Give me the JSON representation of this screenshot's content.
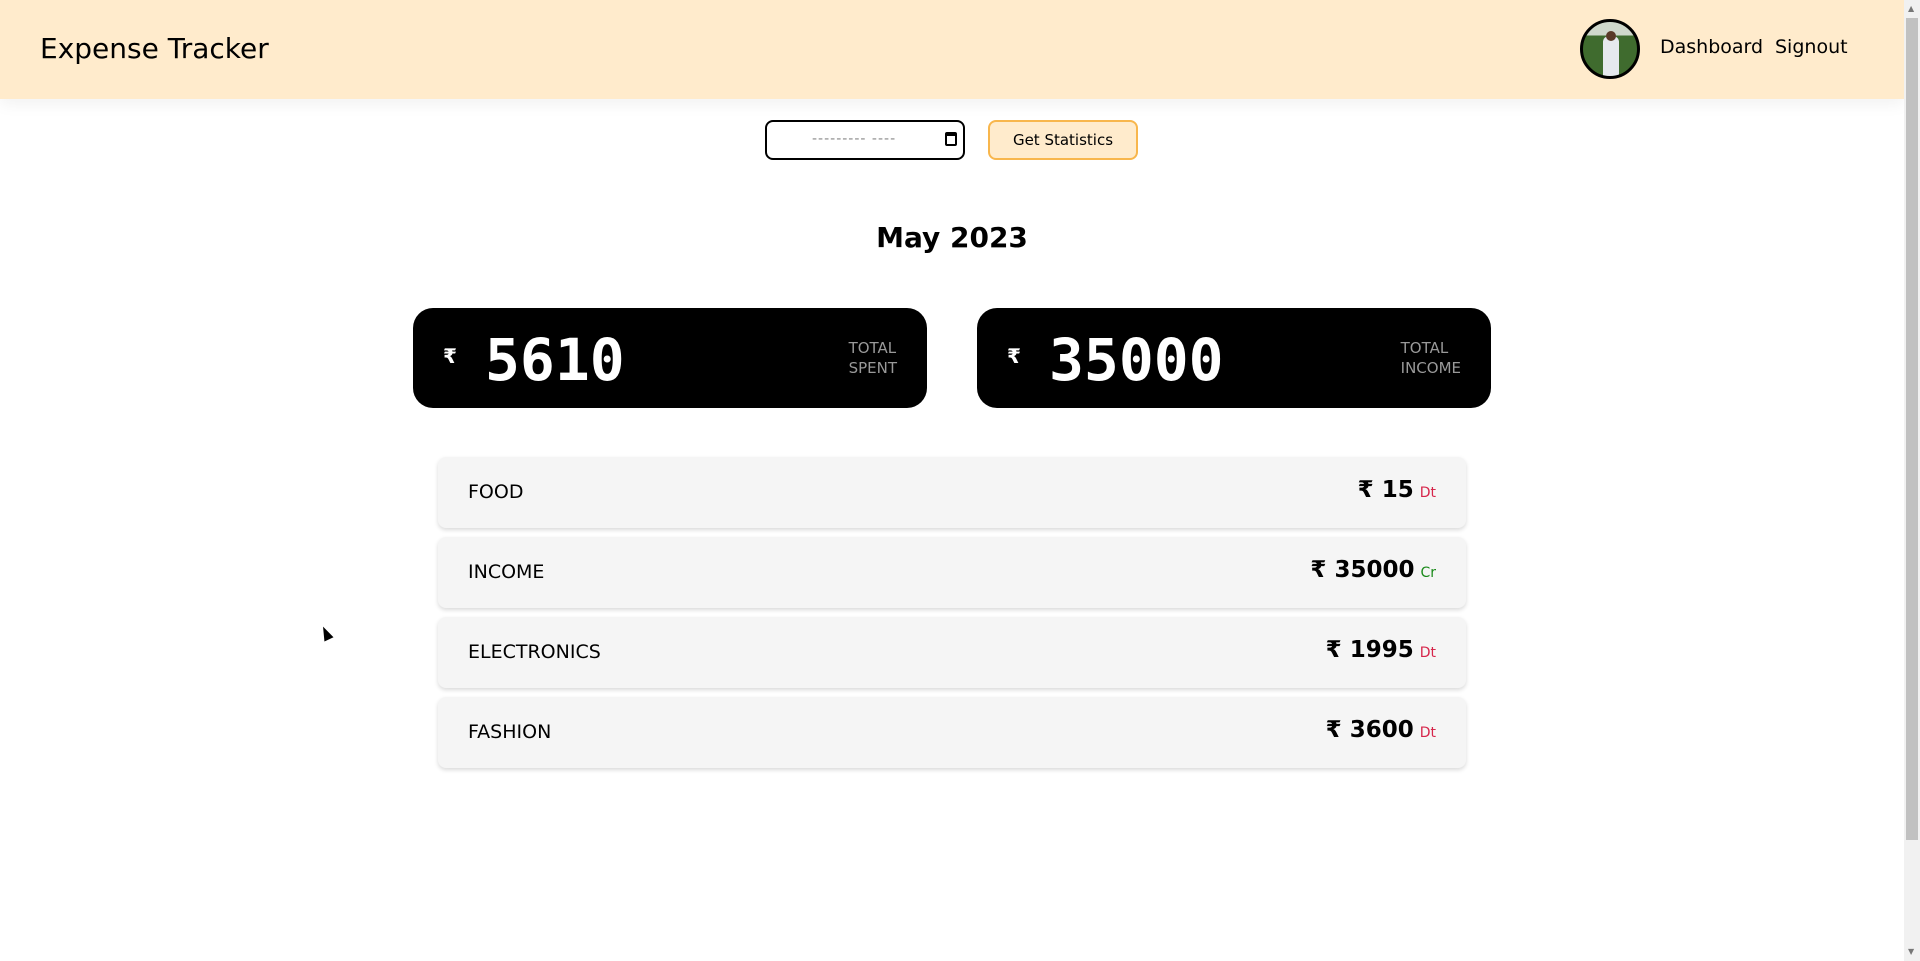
{
  "header": {
    "title": "Expense Tracker",
    "nav": [
      "Dashboard",
      "Signout"
    ]
  },
  "controls": {
    "date_placeholder": "--------- ----",
    "button": "Get Statistics"
  },
  "month": "May 2023",
  "currency": "₹",
  "summary": [
    {
      "value": "5610",
      "label1": "TOTAL",
      "label2": "SPENT"
    },
    {
      "value": "35000",
      "label1": "TOTAL",
      "label2": "INCOME"
    }
  ],
  "categories": [
    {
      "name": "FOOD",
      "amount": "15",
      "type": "Dt"
    },
    {
      "name": "INCOME",
      "amount": "35000",
      "type": "Cr"
    },
    {
      "name": "ELECTRONICS",
      "amount": "1995",
      "type": "Dt"
    },
    {
      "name": "FASHION",
      "amount": "3600",
      "type": "Dt"
    }
  ],
  "colors": {
    "header": "#ffebcc",
    "debit": "#d6254a",
    "credit": "#1a8a1a"
  }
}
